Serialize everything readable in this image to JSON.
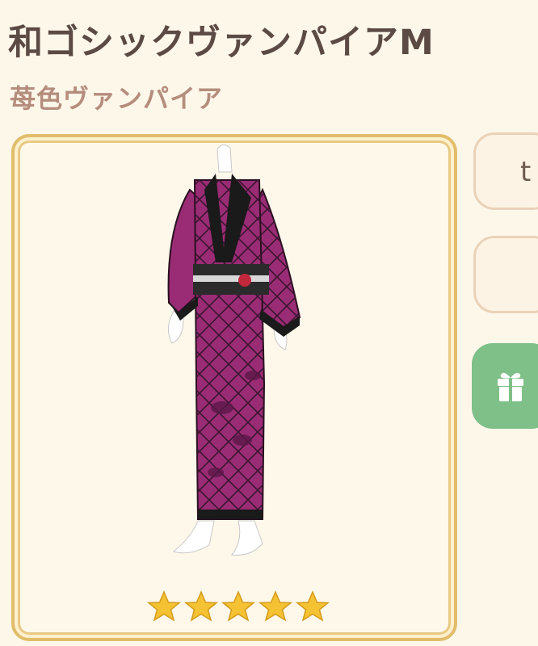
{
  "item": {
    "name": "和ゴシックヴァンパイアM",
    "subtitle": "苺色ヴァンパイア",
    "rarity": 5
  },
  "side_buttons": [
    {
      "label": "t",
      "icon": ""
    },
    {
      "label": "",
      "icon": ""
    },
    {
      "label": "",
      "icon": "gift-icon"
    }
  ],
  "colors": {
    "background": "#fdf7ea",
    "card_frame": "#e2bd6a",
    "kimono": "#9a2c75",
    "gift_button": "#7fbf88",
    "star": "#f4c232"
  }
}
